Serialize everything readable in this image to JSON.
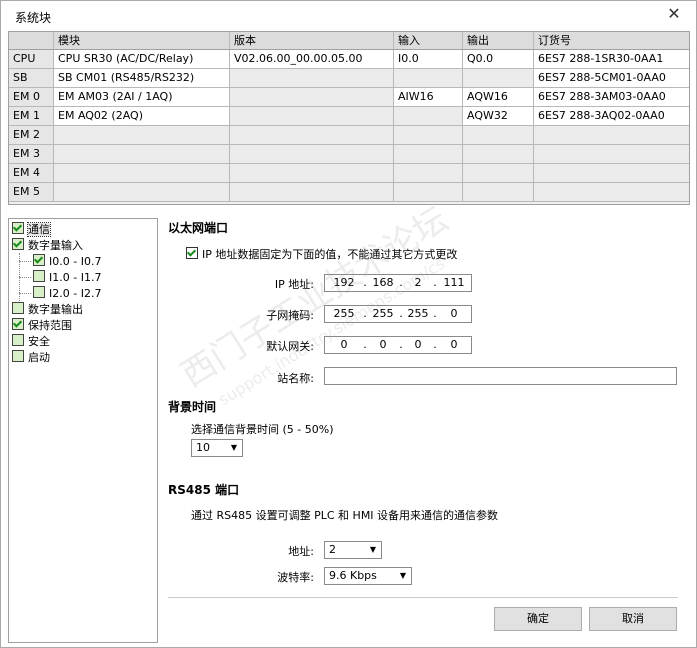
{
  "window": {
    "title": "系统块",
    "close_glyph": "✕"
  },
  "module_table": {
    "headers": [
      "",
      "模块",
      "版本",
      "输入",
      "输出",
      "订货号"
    ],
    "rows": [
      {
        "slot": "CPU",
        "module": "CPU SR30 (AC/DC/Relay)",
        "version": "V02.06.00_00.00.05.00",
        "input": "I0.0",
        "output": "Q0.0",
        "order": "6ES7 288-1SR30-0AA1"
      },
      {
        "slot": "SB",
        "module": "SB CM01 (RS485/RS232)",
        "version": "",
        "input": "",
        "output": "",
        "order": "6ES7 288-5CM01-0AA0"
      },
      {
        "slot": "EM 0",
        "module": "EM AM03 (2AI / 1AQ)",
        "version": "",
        "input": "AIW16",
        "output": "AQW16",
        "order": "6ES7 288-3AM03-0AA0"
      },
      {
        "slot": "EM 1",
        "module": "EM AQ02 (2AQ)",
        "version": "",
        "input": "",
        "output": "AQW32",
        "order": "6ES7 288-3AQ02-0AA0"
      },
      {
        "slot": "EM 2",
        "module": "",
        "version": "",
        "input": "",
        "output": "",
        "order": ""
      },
      {
        "slot": "EM 3",
        "module": "",
        "version": "",
        "input": "",
        "output": "",
        "order": ""
      },
      {
        "slot": "EM 4",
        "module": "",
        "version": "",
        "input": "",
        "output": "",
        "order": ""
      },
      {
        "slot": "EM 5",
        "module": "",
        "version": "",
        "input": "",
        "output": "",
        "order": ""
      }
    ]
  },
  "tree": {
    "items": [
      {
        "label": "通信",
        "checked": true
      },
      {
        "label": "数字量输入",
        "checked": true
      },
      {
        "label": "I0.0 - I0.7",
        "checked": true
      },
      {
        "label": "I1.0 - I1.7",
        "checked": false
      },
      {
        "label": "I2.0 - I2.7",
        "checked": false
      },
      {
        "label": "数字量输出",
        "checked": false
      },
      {
        "label": "保持范围",
        "checked": true
      },
      {
        "label": "安全",
        "checked": false
      },
      {
        "label": "启动",
        "checked": false
      }
    ]
  },
  "ethernet": {
    "title": "以太网端口",
    "fixed_ip_label": "IP 地址数据固定为下面的值，不能通过其它方式更改",
    "fixed_ip_checked": true,
    "ip_label": "IP 地址:",
    "ip": [
      "192",
      "168",
      "2",
      "111"
    ],
    "mask_label": "子网掩码:",
    "mask": [
      "255",
      "255",
      "255",
      "0"
    ],
    "gateway_label": "默认网关:",
    "gateway": [
      "0",
      "0",
      "0",
      "0"
    ],
    "station_label": "站名称:",
    "station_value": ""
  },
  "background_time": {
    "title": "背景时间",
    "select_label": "选择通信背景时间 (5 - 50%)",
    "value": "10"
  },
  "rs485": {
    "title": "RS485 端口",
    "description": "通过 RS485 设置可调整 PLC 和 HMI 设备用来通信的通信参数",
    "address_label": "地址:",
    "address_value": "2",
    "baud_label": "波特率:",
    "baud_value": "9.6 Kbps"
  },
  "buttons": {
    "ok": "确定",
    "cancel": "取消"
  },
  "watermark": {
    "text": "西门子工业技术论坛",
    "sub": "support.industry.siemens.com/cs"
  },
  "colors": {
    "checkmark": "#1a8a1a",
    "header_bg": "#dcdcdc",
    "row_head_bg": "#e6e6e6"
  }
}
